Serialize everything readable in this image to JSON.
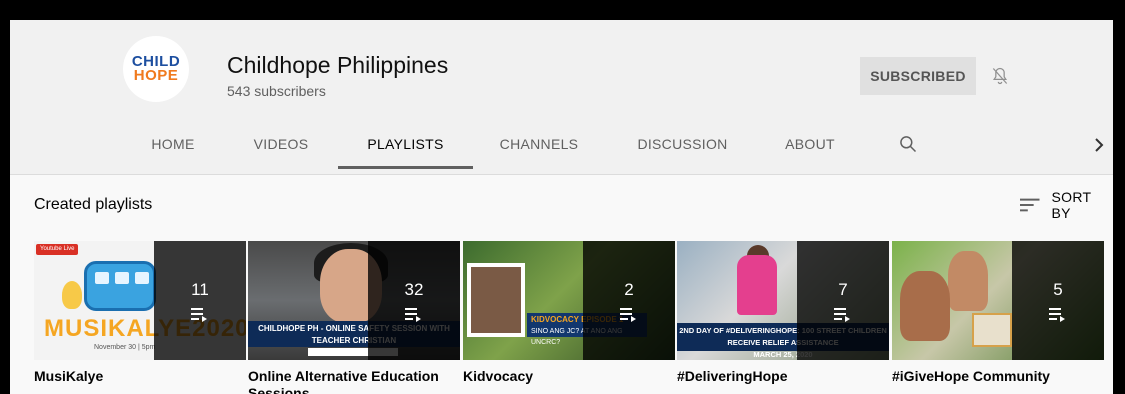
{
  "channel": {
    "avatar": {
      "line1": "CHILD",
      "line2": "HOPE"
    },
    "name": "Childhope Philippines",
    "subscribers": "543 subscribers",
    "subscribe_label": "SUBSCRIBED",
    "bell_icon": "bell-off-icon"
  },
  "tabs": [
    {
      "label": "HOME",
      "active": false
    },
    {
      "label": "VIDEOS",
      "active": false
    },
    {
      "label": "PLAYLISTS",
      "active": true
    },
    {
      "label": "CHANNELS",
      "active": false
    },
    {
      "label": "DISCUSSION",
      "active": false
    },
    {
      "label": "ABOUT",
      "active": false
    }
  ],
  "icons": {
    "search": "search-icon",
    "next": "chevron-right-icon",
    "sort": "sort-icon",
    "playlist": "playlist-icon"
  },
  "section": {
    "title": "Created playlists",
    "sort_label": "SORT BY"
  },
  "playlists": [
    {
      "title": "MusiKalye",
      "count": "11",
      "thumb": {
        "badge": "Youtube Live",
        "big": "MUSIKALYE2020",
        "date": "November 30 | 5pm"
      }
    },
    {
      "title": "Online Alternative Education Sessions",
      "count": "32",
      "thumb": {
        "banner": "CHILDHOPE PH - ONLINE SAFETY SESSION WITH TEACHER CHRISTIAN"
      }
    },
    {
      "title": "Kidvocacy",
      "count": "2",
      "thumb": {
        "heading": "KIDVOCACY EPISODE 1",
        "line": "SINO ANG JC? AT ANO ANG UNCRC?"
      }
    },
    {
      "title": "#DeliveringHope",
      "count": "7",
      "thumb": {
        "banner": "2ND DAY OF #DELIVERINGHOPE: 100 STREET CHILDREN RECEIVE RELIEF ASSISTANCE",
        "date": "MARCH 25, 2020"
      }
    },
    {
      "title": "#iGiveHope Community",
      "count": "5",
      "thumb": {}
    }
  ],
  "colors": {
    "accent": "#606060",
    "header_bg": "#f1f1f1",
    "page_bg": "#f9f9f9",
    "subscribed_bg": "#e0e0e0"
  }
}
